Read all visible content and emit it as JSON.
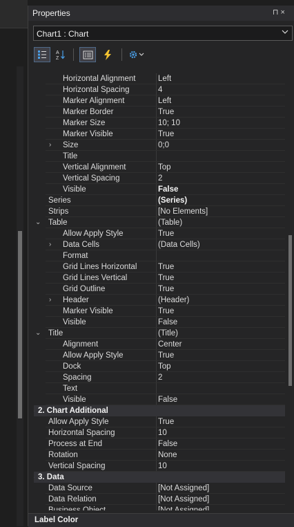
{
  "panel": {
    "title": "Properties",
    "pin_glyph": "⊓ ×"
  },
  "object_select": {
    "value": "Chart1 : Chart"
  },
  "toolbar": {
    "buttons": [
      {
        "name": "categorized-view-icon",
        "active": true
      },
      {
        "name": "alphabetical-sort-icon",
        "active": false
      },
      {
        "name": "properties-view-icon",
        "active": true
      },
      {
        "name": "events-lightning-icon",
        "active": false
      },
      {
        "name": "settings-gear-icon",
        "active": false
      }
    ]
  },
  "rows": [
    {
      "type": "prop",
      "level": 2,
      "name": "Horizontal Alignment",
      "value": "Left"
    },
    {
      "type": "prop",
      "level": 2,
      "name": "Horizontal Spacing",
      "value": "4"
    },
    {
      "type": "prop",
      "level": 2,
      "name": "Marker Alignment",
      "value": "Left"
    },
    {
      "type": "prop",
      "level": 2,
      "name": "Marker Border",
      "value": "True"
    },
    {
      "type": "prop",
      "level": 2,
      "name": "Marker Size",
      "value": "10; 10"
    },
    {
      "type": "prop",
      "level": 2,
      "name": "Marker Visible",
      "value": "True"
    },
    {
      "type": "prop",
      "level": 2,
      "name": "Size",
      "value": "0;0",
      "expand": "›"
    },
    {
      "type": "prop",
      "level": 2,
      "name": "Title",
      "value": ""
    },
    {
      "type": "prop",
      "level": 2,
      "name": "Vertical Alignment",
      "value": "Top"
    },
    {
      "type": "prop",
      "level": 2,
      "name": "Vertical Spacing",
      "value": "2"
    },
    {
      "type": "prop",
      "level": 2,
      "name": "Visible",
      "value": "False",
      "bold": true
    },
    {
      "type": "prop",
      "level": 1,
      "name": "Series",
      "value": "(Series)",
      "bold": true
    },
    {
      "type": "prop",
      "level": 1,
      "name": "Strips",
      "value": "[No Elements]"
    },
    {
      "type": "prop",
      "level": 1,
      "name": "Table",
      "value": "(Table)",
      "collapse": "⌄"
    },
    {
      "type": "prop",
      "level": 2,
      "name": "Allow Apply Style",
      "value": "True"
    },
    {
      "type": "prop",
      "level": 2,
      "name": "Data Cells",
      "value": "(Data Cells)",
      "expand": "›"
    },
    {
      "type": "prop",
      "level": 2,
      "name": "Format",
      "value": ""
    },
    {
      "type": "prop",
      "level": 2,
      "name": "Grid Lines Horizontal",
      "value": "True"
    },
    {
      "type": "prop",
      "level": 2,
      "name": "Grid Lines Vertical",
      "value": "True"
    },
    {
      "type": "prop",
      "level": 2,
      "name": "Grid Outline",
      "value": "True"
    },
    {
      "type": "prop",
      "level": 2,
      "name": "Header",
      "value": "(Header)",
      "expand": "›"
    },
    {
      "type": "prop",
      "level": 2,
      "name": "Marker Visible",
      "value": "True"
    },
    {
      "type": "prop",
      "level": 2,
      "name": "Visible",
      "value": "False"
    },
    {
      "type": "prop",
      "level": 1,
      "name": "Title",
      "value": "(Title)",
      "collapse": "⌄"
    },
    {
      "type": "prop",
      "level": 2,
      "name": "Alignment",
      "value": "Center"
    },
    {
      "type": "prop",
      "level": 2,
      "name": "Allow Apply Style",
      "value": "True"
    },
    {
      "type": "prop",
      "level": 2,
      "name": "Dock",
      "value": "Top"
    },
    {
      "type": "prop",
      "level": 2,
      "name": "Spacing",
      "value": "2"
    },
    {
      "type": "prop",
      "level": 2,
      "name": "Text",
      "value": ""
    },
    {
      "type": "prop",
      "level": 2,
      "name": "Visible",
      "value": "False"
    },
    {
      "type": "category",
      "name": "2. Chart  Additional",
      "collapse": "⌄"
    },
    {
      "type": "prop",
      "level": 1,
      "name": "Allow Apply Style",
      "value": "True"
    },
    {
      "type": "prop",
      "level": 1,
      "name": "Horizontal Spacing",
      "value": "10"
    },
    {
      "type": "prop",
      "level": 1,
      "name": "Process at End",
      "value": "False"
    },
    {
      "type": "prop",
      "level": 1,
      "name": "Rotation",
      "value": "None"
    },
    {
      "type": "prop",
      "level": 1,
      "name": "Vertical Spacing",
      "value": "10"
    },
    {
      "type": "category",
      "name": "3. Data",
      "collapse": "⌄"
    },
    {
      "type": "prop",
      "level": 1,
      "name": "Data Source",
      "value": "[Not Assigned]"
    },
    {
      "type": "prop",
      "level": 1,
      "name": "Data Relation",
      "value": "[Not Assigned]"
    },
    {
      "type": "prop",
      "level": 1,
      "name": "Business Object",
      "value": "[Not Assigned]"
    }
  ],
  "description": {
    "label": "Label Color"
  }
}
